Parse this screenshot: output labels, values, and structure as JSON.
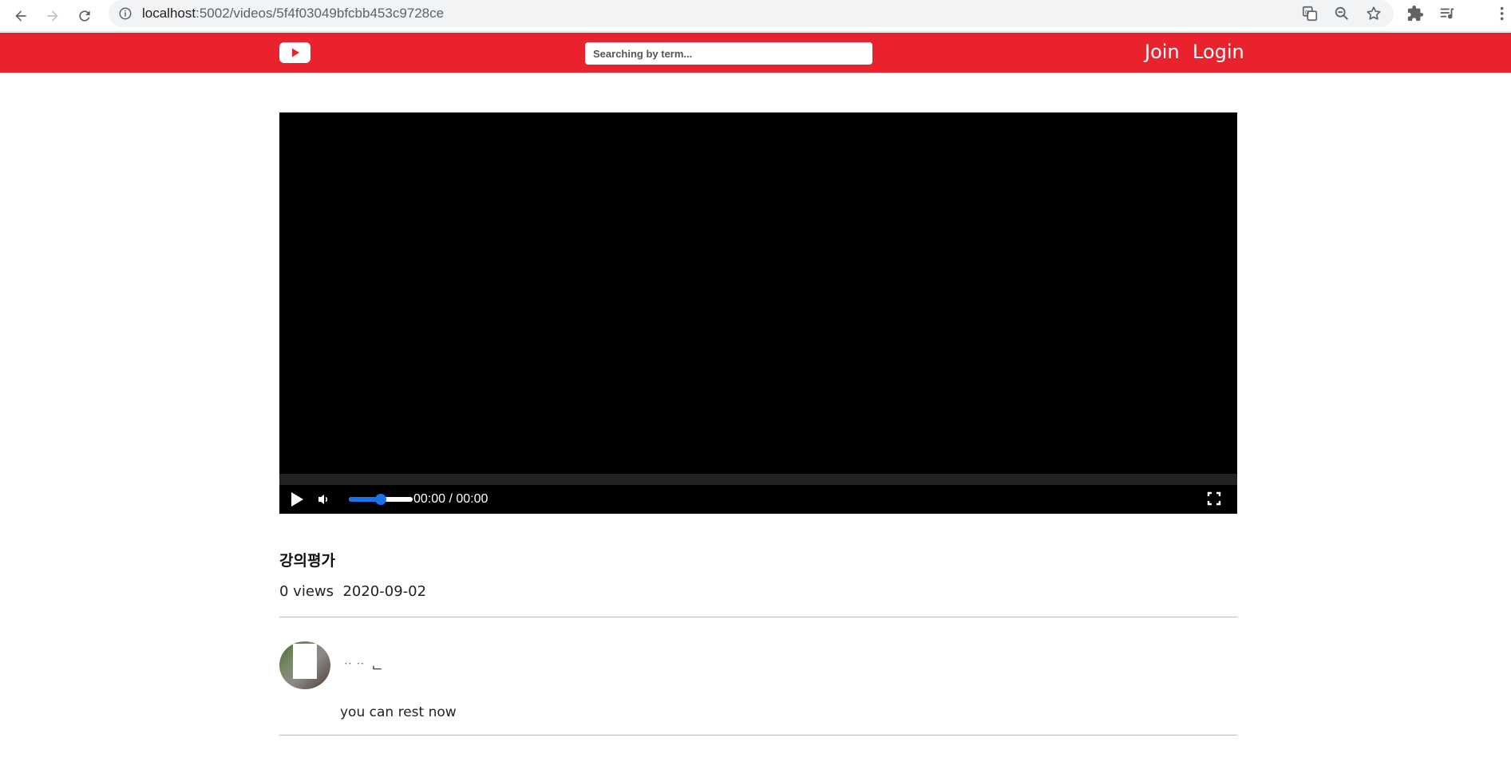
{
  "browser": {
    "url_host": "localhost",
    "url_path": ":5002/videos/5f4f03049bfcbb453c9728ce"
  },
  "header": {
    "search_placeholder": "Searching by term...",
    "join_label": "Join",
    "login_label": "Login",
    "brand_color": "#ea222e"
  },
  "player": {
    "time_display": "00:00 / 00:00",
    "volume_level": 0.5,
    "accent_color": "#1a73e8"
  },
  "video": {
    "title": "강의평가",
    "meta": "0 views  2020-09-02"
  },
  "comments": [
    {
      "author": "ᆢᆢ ᆫ",
      "text": "you can rest now"
    }
  ]
}
